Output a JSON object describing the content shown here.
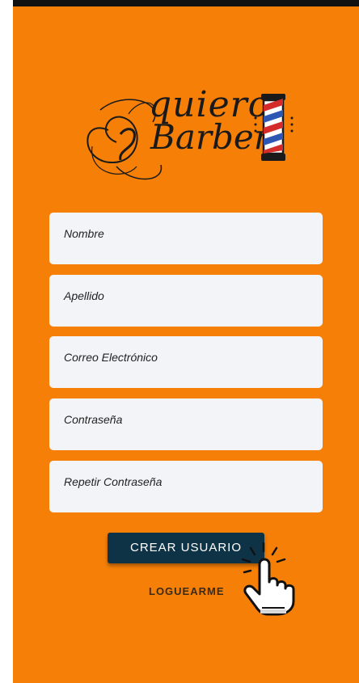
{
  "brand": {
    "logo_line1": "quiero",
    "logo_line2": "Barber",
    "accent_color": "#f57f07",
    "button_color": "#0f3346"
  },
  "form": {
    "fields": [
      {
        "label": "Nombre"
      },
      {
        "label": "Apellido"
      },
      {
        "label": "Correo Electrónico"
      },
      {
        "label": "Contraseña"
      },
      {
        "label": "Repetir Contraseña"
      }
    ],
    "submit_label": "CREAR USUARIO",
    "login_label": "LOGUEARME"
  },
  "overlay": {
    "icon": "pointing-hand-cursor-icon"
  }
}
